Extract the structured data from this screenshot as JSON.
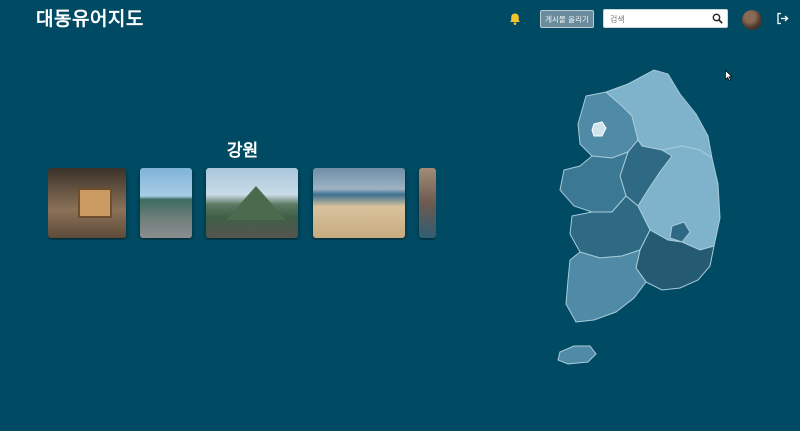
{
  "header": {
    "logo": "대동유어지도",
    "post_button_label": "게시물 올리기",
    "search_placeholder": "검색"
  },
  "main": {
    "region_title": "강원",
    "photos": [
      {
        "name": "cafe-sign-photo"
      },
      {
        "name": "building-photo"
      },
      {
        "name": "mountain-photo"
      },
      {
        "name": "beach-photo"
      },
      {
        "name": "partial-photo"
      }
    ]
  },
  "map": {
    "highlight_region": "강원",
    "colors": {
      "background": "#004b63",
      "region_light": "#7fb3cc",
      "region_mid": "#4f8aa6",
      "region_dark": "#2e6a84",
      "region_darker": "#245a72",
      "border": "#a8cbd9"
    }
  },
  "icons": {
    "bell": "bell-icon",
    "search": "search-icon",
    "logout": "logout-icon"
  }
}
